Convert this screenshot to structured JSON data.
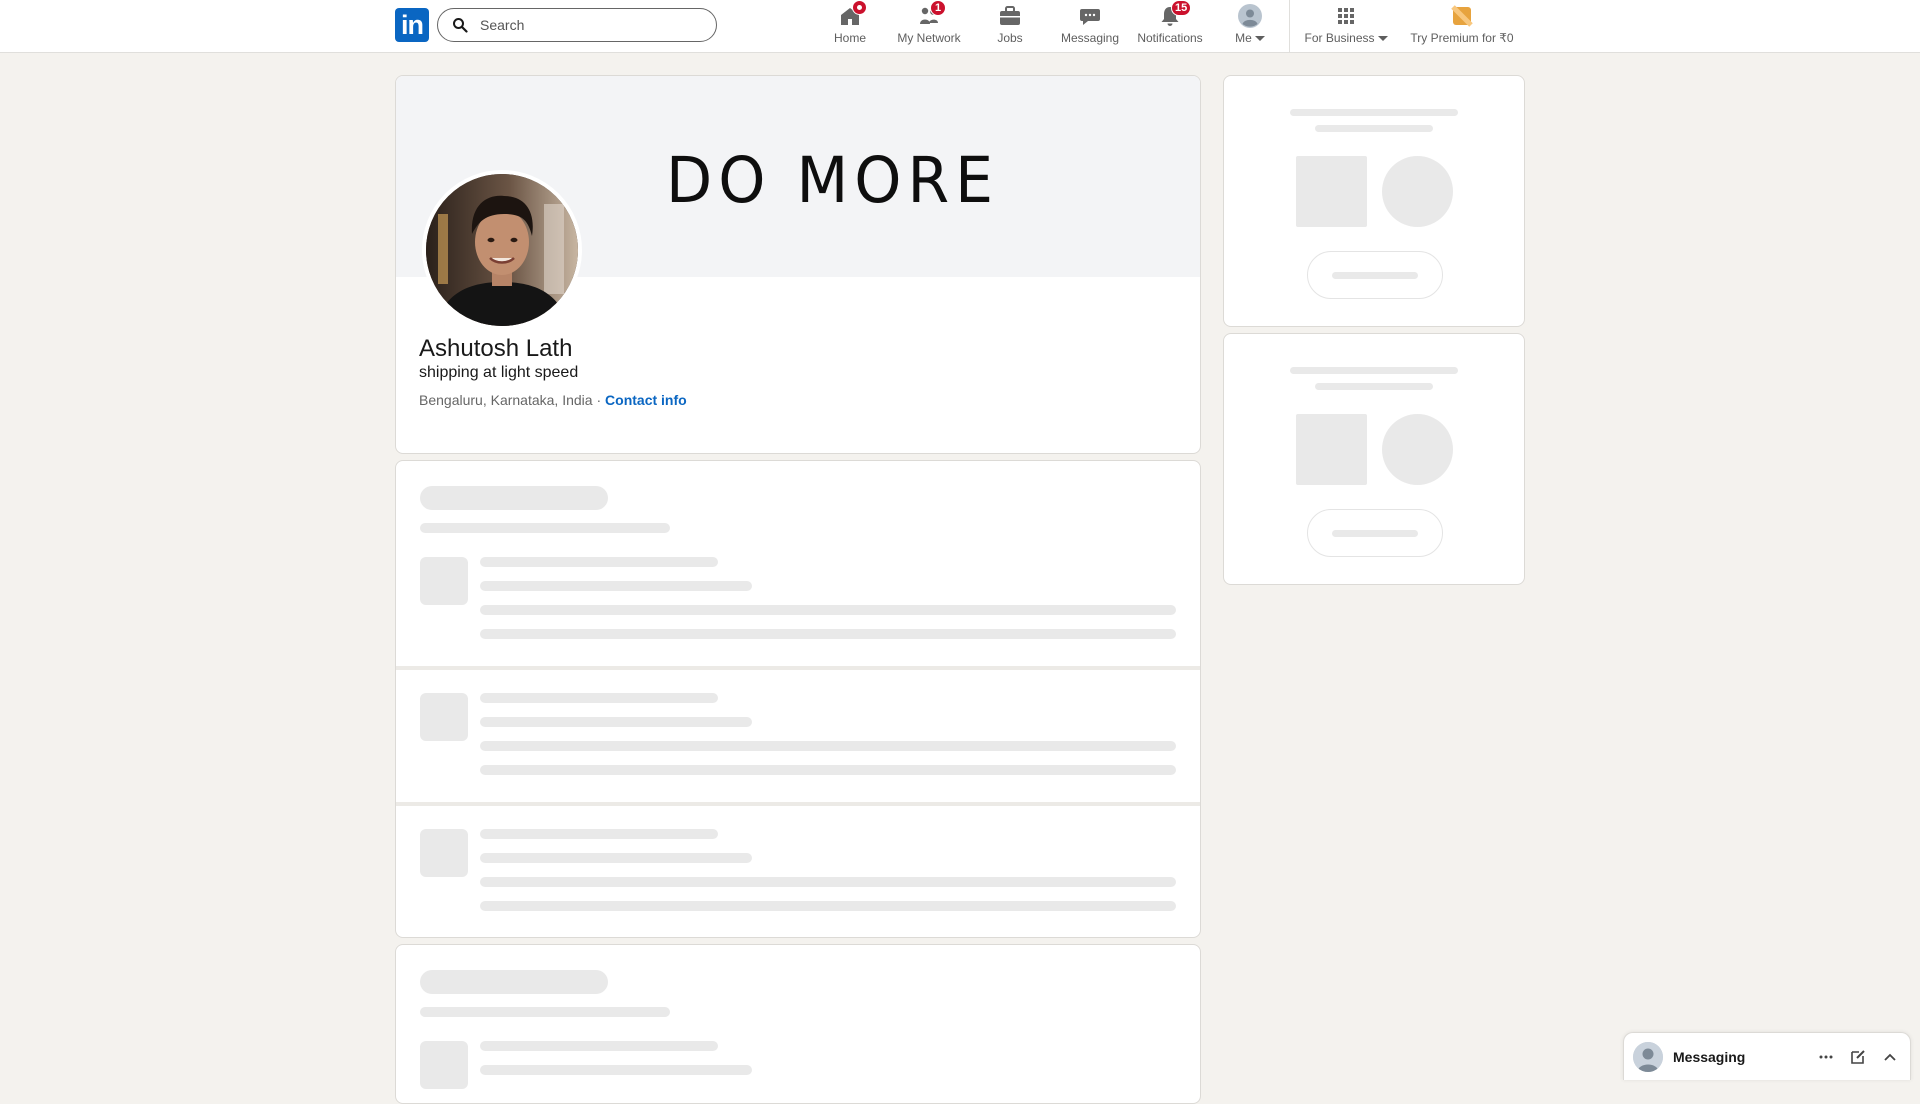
{
  "nav": {
    "logo": "in",
    "search_placeholder": "Search",
    "items": [
      {
        "label": "Home",
        "icon": "home-icon",
        "badge": "dot"
      },
      {
        "label": "My Network",
        "icon": "network-icon",
        "badge": "1"
      },
      {
        "label": "Jobs",
        "icon": "jobs-icon",
        "badge": ""
      },
      {
        "label": "Messaging",
        "icon": "messaging-icon",
        "badge": ""
      },
      {
        "label": "Notifications",
        "icon": "bell-icon",
        "badge": "15"
      },
      {
        "label": "Me",
        "icon": "avatar",
        "badge": ""
      },
      {
        "label": "For Business",
        "icon": "grid-icon",
        "badge": ""
      },
      {
        "label": "Try Premium for ₹0",
        "icon": "premium-icon",
        "badge": ""
      }
    ]
  },
  "profile": {
    "cover_text": "DO MORE",
    "name": "Ashutosh Lath",
    "headline": "shipping at light speed",
    "location": "Bengaluru, Karnataka, India",
    "separator": " · ",
    "contact_label": "Contact info"
  },
  "messaging": {
    "title": "Messaging"
  },
  "colors": {
    "brand": "#0a66c2",
    "badge": "#cb112d",
    "page_bg": "#f4f2ee"
  }
}
